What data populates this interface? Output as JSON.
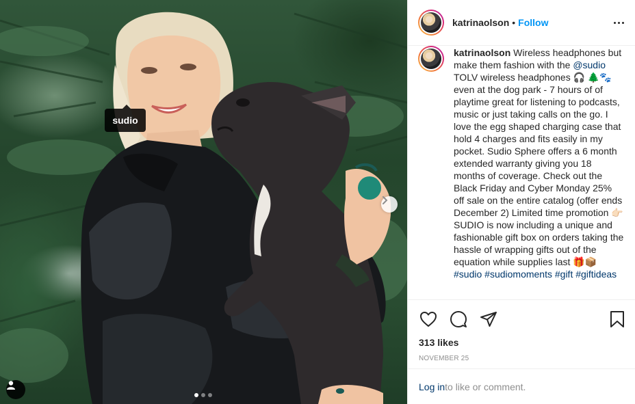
{
  "post": {
    "author": "katrinaolson",
    "separator": "•",
    "follow_label": "Follow",
    "photo_tag": "sudio",
    "caption_author": "katrinaolson",
    "caption_part1": " Wireless headphones but make them fashion with the ",
    "caption_mention": "@sudio",
    "caption_part2": " TOLV wireless headphones 🎧 🌲🐾 even at the dog park - 7 hours of of playtime great for listening to podcasts, music or just taking calls on the go. I love the egg shaped charging case that hold 4 charges and fits easily in my pocket. Sudio Sphere offers a 6 month extended warranty giving you 18 months of coverage. Check out the Black Friday and Cyber Monday 25% off sale on the entire catalog (offer ends December 2) Limited time promotion 👉🏻 SUDIO is now including a unique and fashionable gift box on orders taking the hassle of wrapping gifts out of the equation while supplies last 🎁📦 ",
    "hashtag1": "#sudio",
    "hashtag2": "#sudiomoments",
    "hashtag3": "#gift",
    "hashtag4": "#giftideas",
    "likes": "313 likes",
    "date": "NOVEMBER 25",
    "login_link": "Log in",
    "login_suffix": " to like or comment."
  },
  "carousel": {
    "count": 3,
    "active_index": 0
  },
  "icons": {
    "like": "heart-icon",
    "comment": "comment-icon",
    "share": "share-icon",
    "save": "bookmark-icon",
    "more": "more-options-icon",
    "next": "chevron-right-icon",
    "tags": "user-tag-icon"
  },
  "colors": {
    "link": "#00376b",
    "follow": "#0095f6",
    "muted": "#8e8e8e"
  }
}
